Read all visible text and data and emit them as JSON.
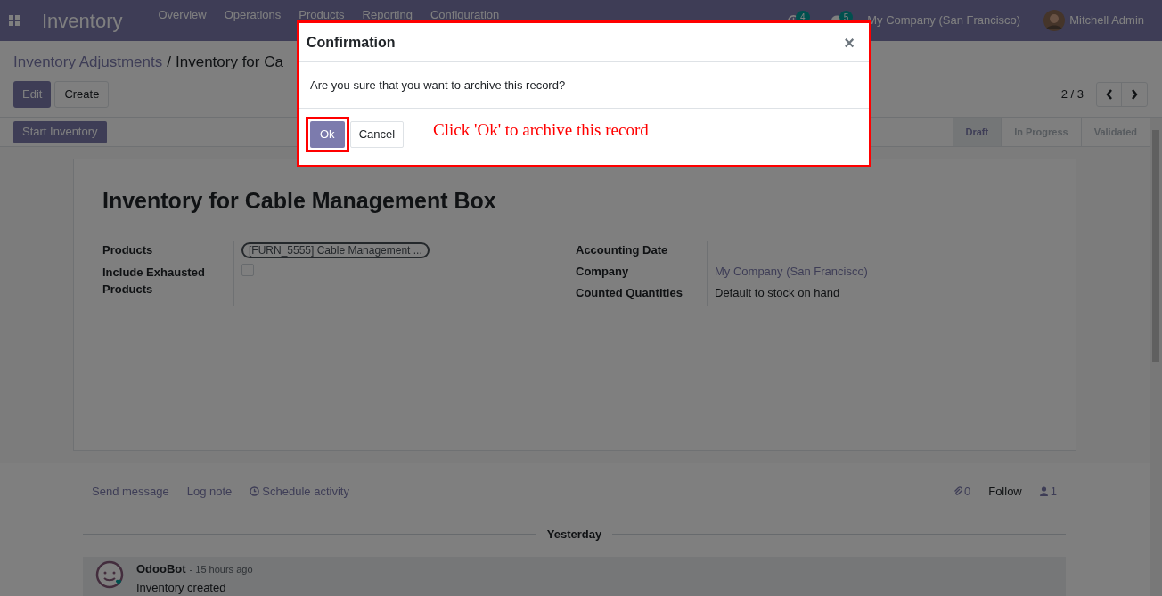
{
  "navbar": {
    "app_name": "Inventory",
    "menu": [
      "Overview",
      "Operations",
      "Products",
      "Reporting",
      "Configuration"
    ],
    "activity_count": "4",
    "message_count": "5",
    "company": "My Company (San Francisco)",
    "user": "Mitchell Admin"
  },
  "breadcrumb": [
    {
      "label": "Inventory Adjustments"
    },
    {
      "separator": "/",
      "label": "Inventory for Ca"
    }
  ],
  "control_buttons": [
    {
      "label": "Edit",
      "kind": "primary"
    },
    {
      "label": "Create",
      "kind": "secondary"
    }
  ],
  "pager": "2 / 3",
  "action_button": "Start Inventory",
  "stages": [
    {
      "label": "Draft",
      "selected": true
    },
    {
      "label": "In Progress",
      "selected": false
    },
    {
      "label": "Validated",
      "selected": false
    }
  ],
  "form": {
    "title": "Inventory for Cable Management Box",
    "left_fields": [
      {
        "label": "Products",
        "kind": "tag",
        "value": "[FURN_5555] Cable Management ..."
      },
      {
        "label": "Include Exhausted Products",
        "kind": "checkbox",
        "checked": false
      }
    ],
    "right_fields": [
      {
        "label": "Accounting Date"
      },
      {
        "label": "Company",
        "kind": "link",
        "value": "My Company (San Francisco)"
      },
      {
        "label": "Counted Quantities",
        "kind": "text",
        "value": "Default to stock on hand"
      }
    ]
  },
  "chatter": {
    "actions": [
      "Send message",
      "Log note",
      "Schedule activity"
    ],
    "attachments": "0",
    "follow": "Follow",
    "followers": "1",
    "date_separator": "Yesterday",
    "messages": [
      {
        "author": "OdooBot",
        "time": "- 15 hours ago",
        "body": "Inventory created"
      }
    ]
  },
  "dialog": {
    "title": "Confirmation",
    "close": "×",
    "message": "Are you sure that you want to archive this record?",
    "buttons": [
      {
        "label": "Ok",
        "kind": "primary"
      },
      {
        "label": "Cancel",
        "kind": "secondary"
      }
    ],
    "annotation": "Click 'Ok' to archive this record"
  }
}
